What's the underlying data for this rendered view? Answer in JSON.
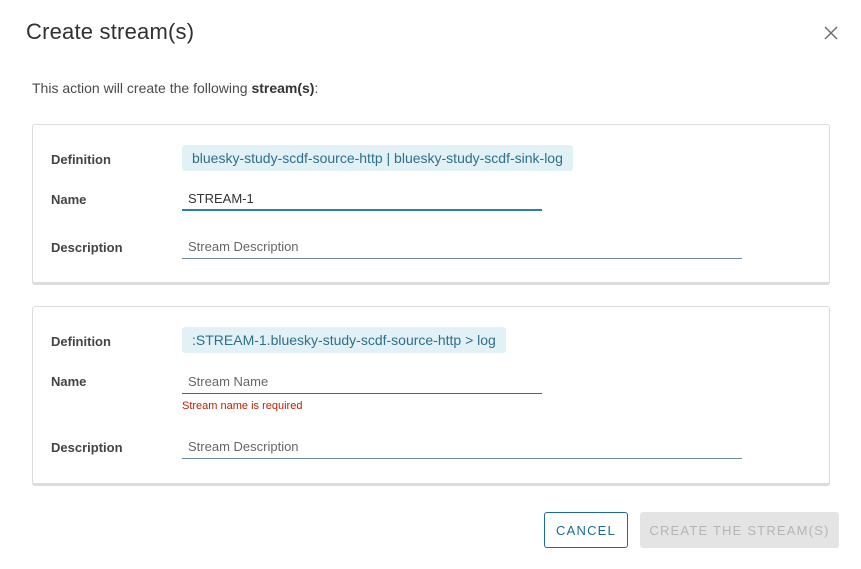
{
  "dialog": {
    "title": "Create stream(s)",
    "intro_prefix": "This action will create the following ",
    "intro_bold": "stream(s)",
    "intro_suffix": ":"
  },
  "streams": [
    {
      "definition_label": "Definition",
      "definition": "bluesky-study-scdf-source-http | bluesky-study-scdf-sink-log",
      "name_label": "Name",
      "name_value": "STREAM-1",
      "name_placeholder": "Stream Name",
      "description_label": "Description",
      "description_value": "",
      "description_placeholder": "Stream Description"
    },
    {
      "definition_label": "Definition",
      "definition": ":STREAM-1.bluesky-study-scdf-source-http > log",
      "name_label": "Name",
      "name_value": "",
      "name_placeholder": "Stream Name",
      "name_error": "Stream name is required",
      "description_label": "Description",
      "description_value": "",
      "description_placeholder": "Stream Description"
    }
  ],
  "footer": {
    "cancel_label": "CANCEL",
    "create_label": "CREATE THE STREAM(S)"
  },
  "icons": {
    "close": "close-icon"
  },
  "colors": {
    "accent": "#2c7fac",
    "chip_bg": "#e1f1f6",
    "chip_text": "#2f6f8a",
    "error": "#c21d00",
    "disabled_bg": "#e4e4e4"
  }
}
